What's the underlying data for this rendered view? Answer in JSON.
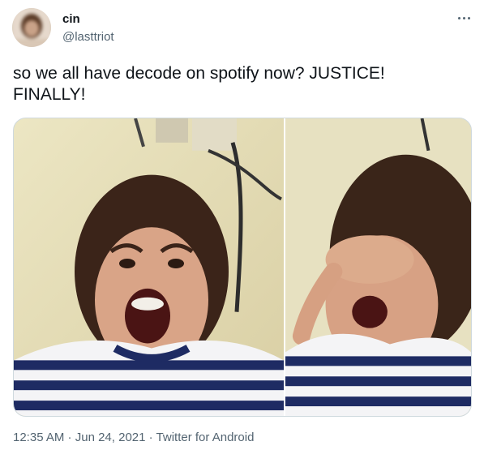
{
  "user": {
    "display_name": "cin",
    "handle": "@lasttriot",
    "avatar_icon": "avatar-photo"
  },
  "more_icon": "more-options-icon",
  "tweet": {
    "text": "so we all have decode on spotify now? JUSTICE!\nFINALLY!"
  },
  "media": {
    "left_image": "photo-girl-screaming",
    "right_image": "photo-girl-crying"
  },
  "meta": {
    "time": "12:35 AM",
    "separator_1": " · ",
    "date": "Jun 24, 2021",
    "separator_2": " · ",
    "source": "Twitter for Android"
  },
  "colors": {
    "text_primary": "#0f1419",
    "text_secondary": "#536471",
    "border": "#cfd9de"
  }
}
